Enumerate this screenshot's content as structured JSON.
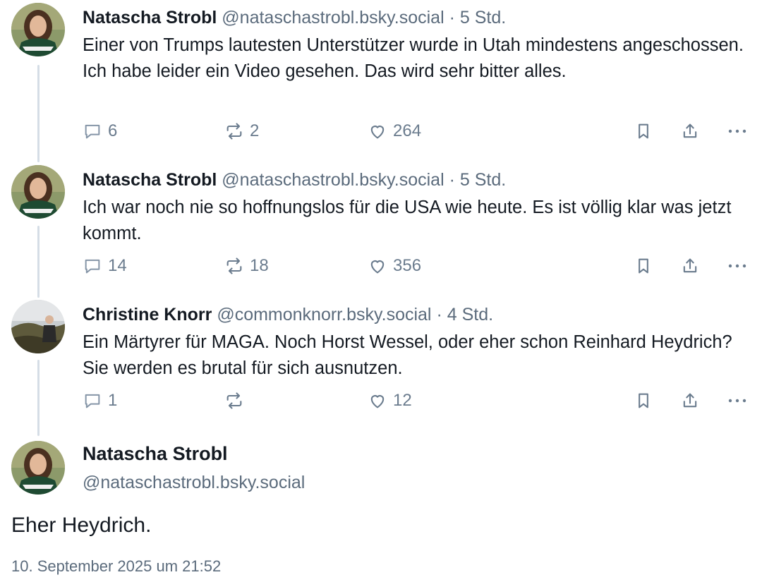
{
  "posts": [
    {
      "author": "Natascha Strobl",
      "handle": "@nataschastrobl.bsky.social",
      "separator": "·",
      "time": "5 Std.",
      "text": "Einer von Trumps lautesten Unterstützer wurde in Utah mindestens angeschossen. Ich habe leider ein Video gesehen. Das wird sehr bitter alles.",
      "replies": "6",
      "reposts": "2",
      "likes": "264",
      "avatar_icon": "natascha-avatar"
    },
    {
      "author": "Natascha Strobl",
      "handle": "@nataschastrobl.bsky.social",
      "separator": "·",
      "time": "5 Std.",
      "text": "Ich war noch nie so hoffnungslos für die USA wie heute. Es ist völlig klar was jetzt kommt.",
      "replies": "14",
      "reposts": "18",
      "likes": "356",
      "avatar_icon": "natascha-avatar"
    },
    {
      "author": "Christine Knorr",
      "handle": "@commonknorr.bsky.social",
      "separator": "·",
      "time": "4 Std.",
      "text": "Ein Märtyrer für MAGA. Noch Horst Wessel, oder eher schon Reinhard Heydrich? Sie werden es brutal für sich ausnutzen.",
      "replies": "1",
      "reposts": "",
      "likes": "12",
      "avatar_icon": "christine-avatar"
    }
  ],
  "main_post": {
    "author": "Natascha Strobl",
    "handle": "@nataschastrobl.bsky.social",
    "text": "Eher Heydrich.",
    "date": "10. September 2025 um 21:52"
  },
  "colors": {
    "text": "#141a22",
    "muted": "#5b6b7c",
    "icon": "#6b7c8e",
    "thread_line": "#d5dde6"
  },
  "icons": [
    "reply-icon",
    "repost-icon",
    "like-icon",
    "bookmark-icon",
    "share-icon",
    "more-icon"
  ]
}
